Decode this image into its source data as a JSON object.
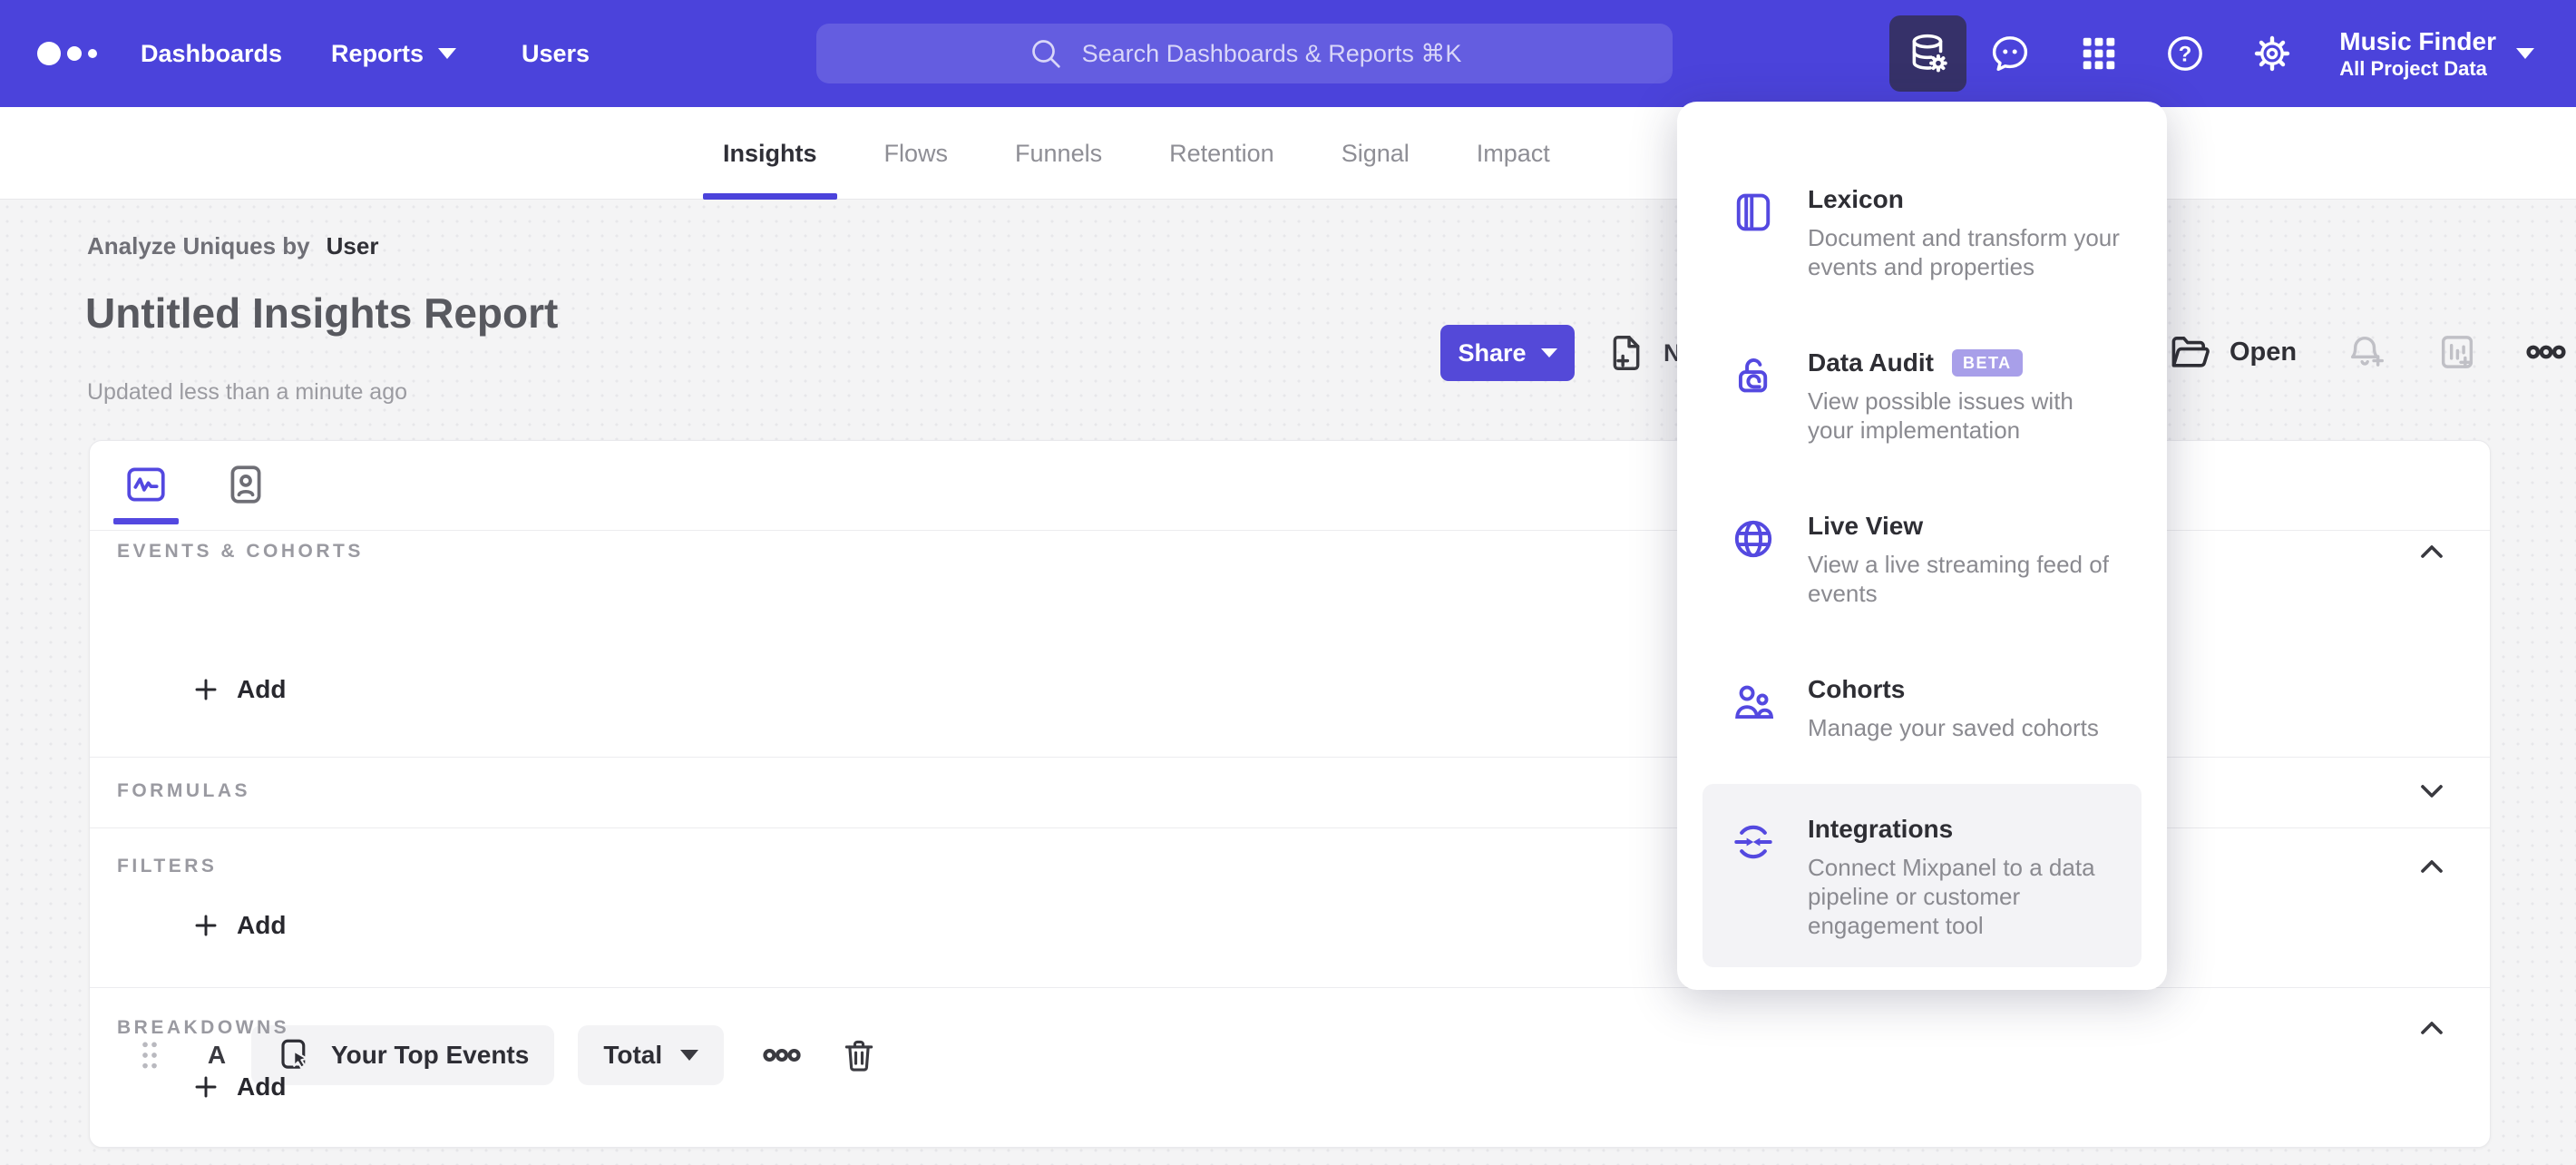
{
  "colors": {
    "header_purple": "#4b43db",
    "accent_purple": "#5348e0",
    "share_button": "#5449d8",
    "active_icon_bg": "#363169",
    "beta_badge_bg": "#a89fe9",
    "page_bg": "#f4f4f5",
    "card_bg": "#ffffff"
  },
  "header": {
    "nav": [
      {
        "label": "Dashboards"
      },
      {
        "label": "Reports"
      },
      {
        "label": "Users"
      }
    ],
    "search_placeholder": "Search Dashboards & Reports ⌘K",
    "project": {
      "name": "Music Finder",
      "subtitle": "All Project Data"
    }
  },
  "tabs": [
    {
      "label": "Insights",
      "active": true
    },
    {
      "label": "Flows",
      "active": false
    },
    {
      "label": "Funnels",
      "active": false
    },
    {
      "label": "Retention",
      "active": false
    },
    {
      "label": "Signal",
      "active": false
    },
    {
      "label": "Impact",
      "active": false
    }
  ],
  "report": {
    "analyze_prefix": "Analyze Uniques by",
    "analyze_value": "User",
    "title": "Untitled Insights Report",
    "updated": "Updated less than a minute ago",
    "share_label": "Share",
    "new_label": "New",
    "open_label": "Open"
  },
  "builder": {
    "sections": {
      "events": "EVENTS & COHORTS",
      "formulas": "FORMULAS",
      "filters": "FILTERS",
      "breakdowns": "BREAKDOWNS"
    },
    "event_row": {
      "letter": "A",
      "event": "Your Top Events",
      "aggregation": "Total"
    },
    "add_label": "Add"
  },
  "menu": {
    "items": [
      {
        "title": "Lexicon",
        "description": "Document and transform your events and properties"
      },
      {
        "title": "Data Audit",
        "badge": "BETA",
        "description": "View possible issues with your implementation"
      },
      {
        "title": "Live View",
        "description": "View a live streaming feed of events"
      },
      {
        "title": "Cohorts",
        "description": "Manage your saved cohorts"
      },
      {
        "title": "Integrations",
        "description": "Connect Mixpanel to a data pipeline or customer engagement tool"
      }
    ]
  }
}
